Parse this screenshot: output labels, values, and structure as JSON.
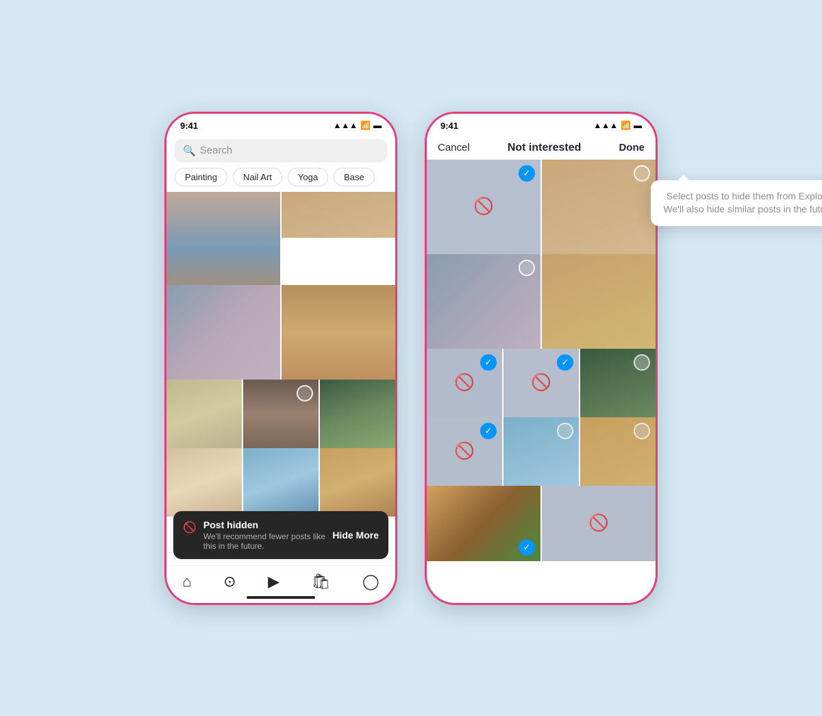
{
  "left_phone": {
    "status": {
      "time": "9:41",
      "signal": "●●●",
      "wifi": "wifi",
      "battery": "battery"
    },
    "search": {
      "placeholder": "Search"
    },
    "chips": [
      "Painting",
      "Nail Art",
      "Yoga",
      "Base"
    ],
    "toast": {
      "title": "Post hidden",
      "subtitle": "We'll recommend fewer posts like this in the future.",
      "action": "Hide More"
    },
    "nav_icons": [
      "home",
      "search",
      "reels",
      "shop",
      "profile"
    ]
  },
  "right_phone": {
    "status": {
      "time": "9:41"
    },
    "header": {
      "cancel": "Cancel",
      "title": "Not interested",
      "done": "Done"
    },
    "tooltip": "Select posts to hide them from Explore. We'll also hide similar posts in the future."
  },
  "colors": {
    "brand_pink": "#e0407a",
    "accent_blue": "#0095f6",
    "background": "#d6e8f5"
  }
}
